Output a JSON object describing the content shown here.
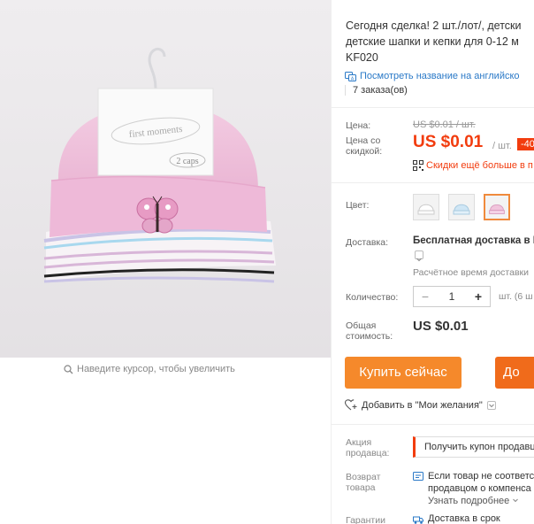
{
  "gallery": {
    "zoom_hint": "Наведите курсор, чтобы увеличить"
  },
  "product": {
    "title_lines": [
      "Сегодня сделка! 2 шт./лот/, детски",
      "детские шапки и кепки для 0-12 м",
      "KF020"
    ],
    "translate_link": "Посмотреть название на английско",
    "orders": "7 заказа(ов)"
  },
  "price": {
    "label": "Цена:",
    "old": "US $0.01 / шт.",
    "discount_label_line1": "Цена со",
    "discount_label_line2": "скидкой:",
    "new": "US $0.01",
    "unit": "/ шт.",
    "badge": "-40",
    "promo_text": "Скидки ещё больше в п"
  },
  "color": {
    "label": "Цвет:",
    "options": [
      "white",
      "blue",
      "pink"
    ],
    "selected": "pink"
  },
  "shipping": {
    "label": "Доставка:",
    "value": "Бесплатная доставка в Ru",
    "estimate": "Расчётное время доставки"
  },
  "quantity": {
    "label": "Количество:",
    "minus": "−",
    "value": "1",
    "plus": "+",
    "unit": "шт. (6 ш"
  },
  "total": {
    "label_line1": "Общая",
    "label_line2": "стоимость:",
    "value": "US $0.01"
  },
  "actions": {
    "buy_now": "Купить сейчас",
    "add_to_cart": "До",
    "wishlist": "Добавить в \"Мои желания\""
  },
  "seller_promo": {
    "label_line1": "Акция",
    "label_line2": "продавца:",
    "coupon": "Получить купон продавц"
  },
  "returns": {
    "label_line1": "Возврат",
    "label_line2": "товара",
    "line1": "Если товар не соответс",
    "line2": "продавцом о компенса",
    "more": "Узнать подробнее"
  },
  "guarantee": {
    "label": "Гарантии",
    "value": "Доставка в срок"
  },
  "colors": {
    "accent": "#f23c0e",
    "buy": "#f5892b",
    "cart": "#f06b1b",
    "link": "#2a79c7"
  }
}
